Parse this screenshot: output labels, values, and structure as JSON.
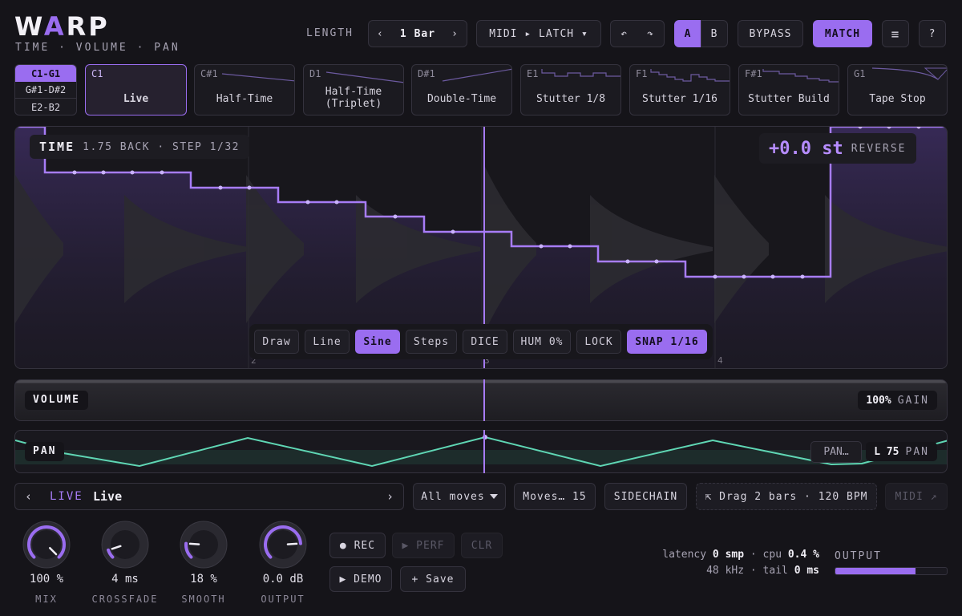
{
  "header": {
    "logo_w": "W",
    "logo_a": "A",
    "logo_rp": "RP",
    "subtitle": "TIME · VOLUME · PAN",
    "length_label": "LENGTH",
    "length_prev": "‹",
    "length_value": "1 Bar",
    "length_next": "›",
    "midi_mode": "MIDI ▸ LATCH ▾",
    "undo": "↶",
    "redo": "↷",
    "ab_a": "A",
    "ab_b": "B",
    "bypass": "BYPASS",
    "match": "MATCH",
    "menu": "≡",
    "help": "?"
  },
  "range_tabs": [
    "C1-G1",
    "G#1-D#2",
    "E2-B2"
  ],
  "slots": [
    {
      "note": "C1",
      "name": "Live"
    },
    {
      "note": "C#1",
      "name": "Half-Time"
    },
    {
      "note": "D1",
      "name": "Half-Time\n(Triplet)"
    },
    {
      "note": "D#1",
      "name": "Double-Time"
    },
    {
      "note": "E1",
      "name": "Stutter 1/8"
    },
    {
      "note": "F1",
      "name": "Stutter 1/16"
    },
    {
      "note": "F#1",
      "name": "Stutter Build"
    },
    {
      "note": "G1",
      "name": "Tape Stop"
    }
  ],
  "time_lane": {
    "title": "TIME",
    "info": "1.75 BACK · STEP 1/32",
    "pitch_value": "+0.0 st",
    "reverse": "REVERSE",
    "bar_numbers": [
      "2",
      "3",
      "4"
    ]
  },
  "tools": [
    "Draw",
    "Line",
    "Sine",
    "Steps",
    "DICE",
    "HUM 0%",
    "LOCK",
    "SNAP 1/16"
  ],
  "volume_lane": {
    "title": "VOLUME",
    "value": "100%",
    "unit": "GAIN"
  },
  "pan_lane": {
    "title": "PAN",
    "button": "PAN…",
    "value": "L 75",
    "unit": "PAN"
  },
  "preset_bar": {
    "prev": "‹",
    "tag": "LIVE",
    "name": "Live",
    "next": "›",
    "moves_filter": "All moves",
    "moves_count": "Moves… 15",
    "sidechain": "SIDECHAIN",
    "drag": "⇱ Drag 2 bars · 120 BPM",
    "midi_export": "MIDI ↗"
  },
  "knobs": [
    {
      "value": "100 %",
      "label": "MIX",
      "level": 1.0
    },
    {
      "value": "4 ms",
      "label": "CROSSFADE",
      "level": 0.1
    },
    {
      "value": "18 %",
      "label": "SMOOTH",
      "level": 0.18
    },
    {
      "value": "0.0 dB",
      "label": "OUTPUT",
      "level": 0.82
    }
  ],
  "transport": {
    "rec": "● REC",
    "perf": "▶ PERF",
    "clr": "CLR",
    "demo": "▶ DEMO",
    "save": "+ Save"
  },
  "status": {
    "latency_label": "latency",
    "latency_value": "0 smp",
    "cpu_label": "cpu",
    "cpu_value": "0.4 %",
    "rate": "48 kHz",
    "tail_label": "tail",
    "tail_value": "0 ms",
    "sep": "·",
    "output_label": "OUTPUT",
    "output_level": 0.72
  },
  "colors": {
    "accent": "#9a6df0",
    "pan": "#5fd6b4",
    "background": "#151419"
  }
}
